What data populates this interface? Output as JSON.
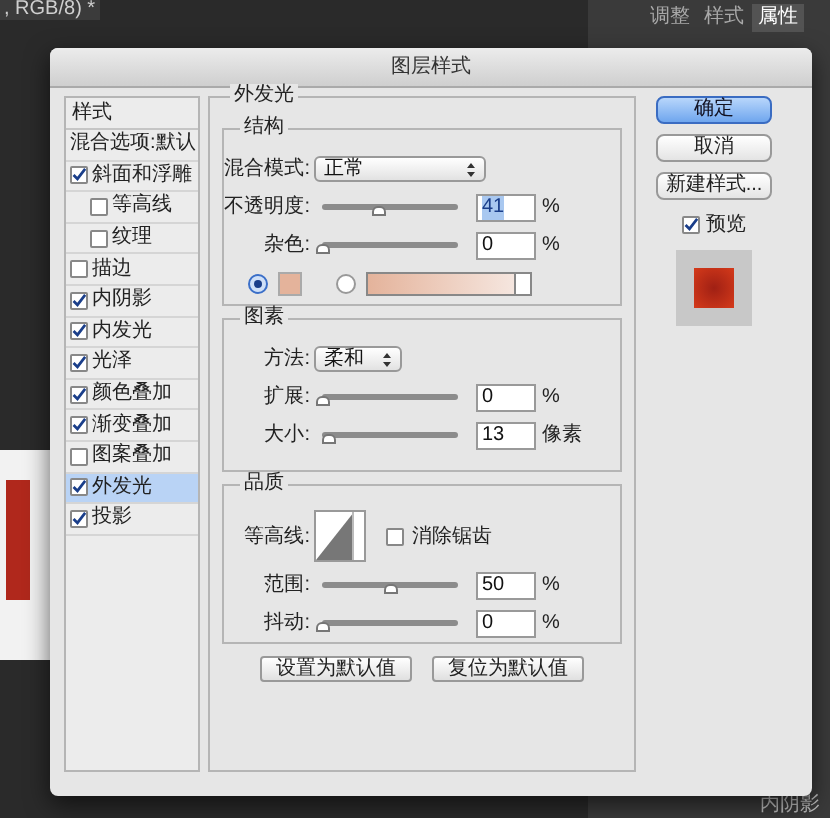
{
  "app": {
    "doc_tab": ", RGB/8) *",
    "panel_tabs": [
      {
        "label": "调整",
        "selected": false
      },
      {
        "label": "样式",
        "selected": false
      },
      {
        "label": "属性",
        "selected": true
      }
    ],
    "panel_item": "内阴影"
  },
  "dialog": {
    "title": "图层样式",
    "styles_list": {
      "header": "样式",
      "items": [
        {
          "label": "混合选项:默认",
          "kind": "plain",
          "selected": false
        },
        {
          "label": "斜面和浮雕",
          "kind": "check",
          "checked": true,
          "selected": false,
          "children": [
            {
              "label": "等高线",
              "kind": "check",
              "checked": false,
              "selected": false
            },
            {
              "label": "纹理",
              "kind": "check",
              "checked": false,
              "selected": false
            }
          ]
        },
        {
          "label": "描边",
          "kind": "check",
          "checked": false,
          "selected": false
        },
        {
          "label": "内阴影",
          "kind": "check",
          "checked": true,
          "selected": false
        },
        {
          "label": "内发光",
          "kind": "check",
          "checked": true,
          "selected": false
        },
        {
          "label": "光泽",
          "kind": "check",
          "checked": true,
          "selected": false
        },
        {
          "label": "颜色叠加",
          "kind": "check",
          "checked": true,
          "selected": false
        },
        {
          "label": "渐变叠加",
          "kind": "check",
          "checked": true,
          "selected": false
        },
        {
          "label": "图案叠加",
          "kind": "check",
          "checked": false,
          "selected": false
        },
        {
          "label": "外发光",
          "kind": "check",
          "checked": true,
          "selected": true
        },
        {
          "label": "投影",
          "kind": "check",
          "checked": true,
          "selected": false
        }
      ]
    },
    "panel": {
      "title": "外发光",
      "groups": [
        {
          "title": "结构",
          "rows": [
            {
              "kind": "select",
              "label": "混合模式:",
              "value": "正常"
            },
            {
              "kind": "slider",
              "label": "不透明度:",
              "level": 0.41,
              "value": "41",
              "unit": "%",
              "highlighted": true
            },
            {
              "kind": "slider",
              "label": "杂色:",
              "level": 0,
              "value": "0",
              "unit": "%",
              "highlighted": false
            },
            {
              "kind": "color",
              "options": [
                {
                  "kind": "swatch",
                  "selected": true
                },
                {
                  "kind": "gradient",
                  "selected": false
                }
              ]
            }
          ]
        },
        {
          "title": "图素",
          "rows": [
            {
              "kind": "select",
              "label": "方法:",
              "value": "柔和"
            },
            {
              "kind": "slider",
              "label": "扩展:",
              "level": 0,
              "value": "0",
              "unit": "%",
              "highlighted": false
            },
            {
              "kind": "slider",
              "label": "大小:",
              "level": 0.05,
              "value": "13",
              "unit": "像素",
              "highlighted": false
            }
          ]
        },
        {
          "title": "品质",
          "rows": [
            {
              "kind": "contour",
              "label": "等高线:",
              "option": "消除锯齿",
              "checked": false
            },
            {
              "kind": "slider",
              "label": "范围:",
              "level": 0.5,
              "value": "50",
              "unit": "%",
              "highlighted": false
            },
            {
              "kind": "slider",
              "label": "抖动:",
              "level": 0,
              "value": "0",
              "unit": "%",
              "highlighted": false
            }
          ]
        }
      ],
      "buttons": [
        "设置为默认值",
        "复位为默认值"
      ]
    },
    "side": {
      "buttons": [
        {
          "label": "确定",
          "primary": true
        },
        {
          "label": "取消",
          "primary": false
        },
        {
          "label": "新建样式...",
          "primary": false
        }
      ],
      "preview": {
        "label": "预览",
        "checked": true
      }
    }
  }
}
